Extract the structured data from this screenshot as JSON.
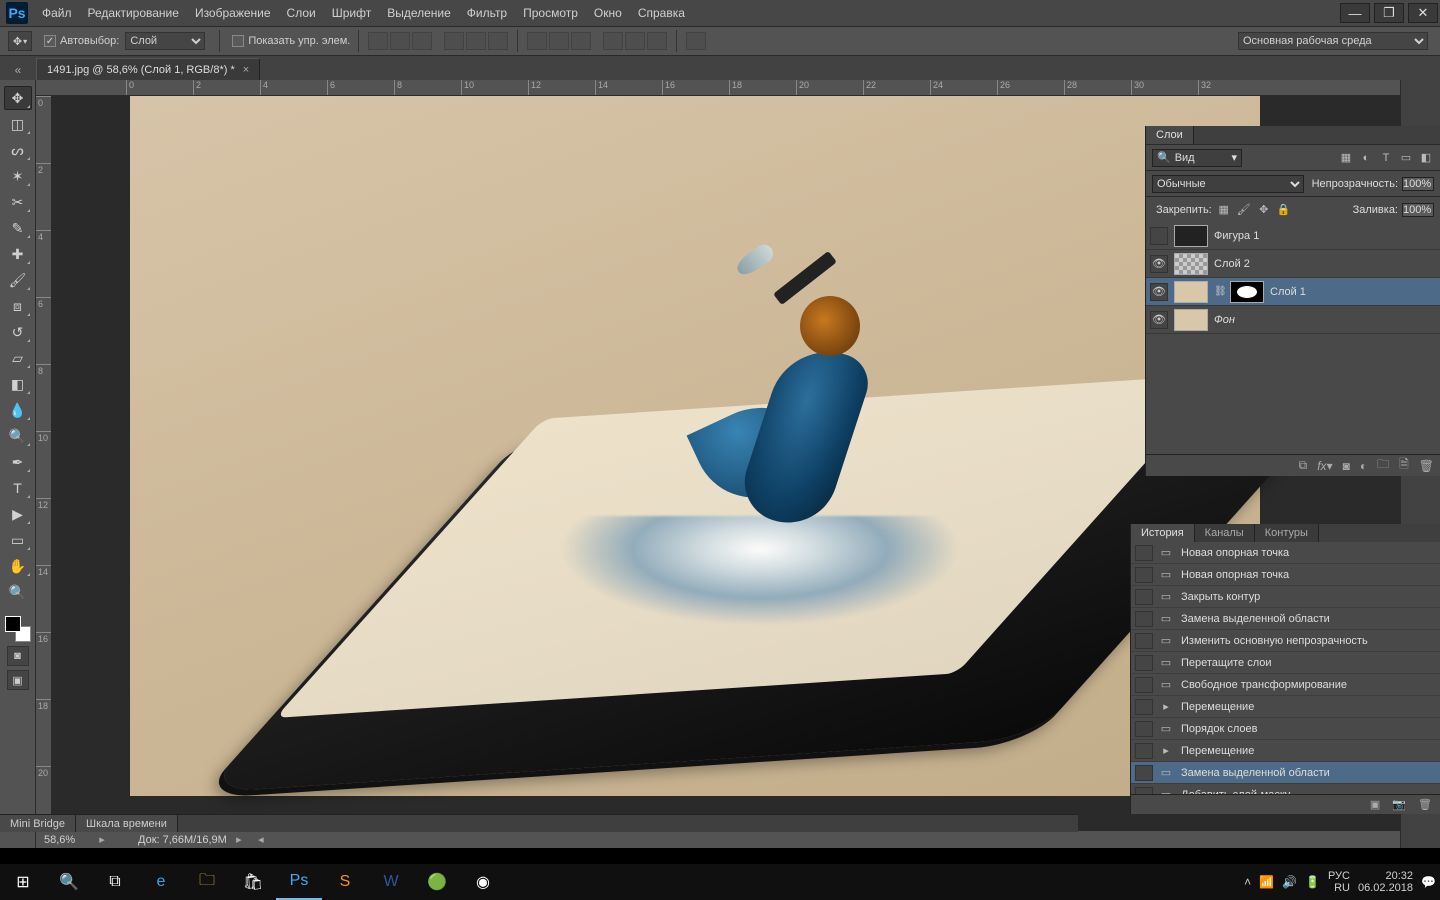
{
  "app": {
    "logo": "Ps"
  },
  "menu": [
    "Файл",
    "Редактирование",
    "Изображение",
    "Слои",
    "Шрифт",
    "Выделение",
    "Фильтр",
    "Просмотр",
    "Окно",
    "Справка"
  ],
  "options": {
    "auto_select_label": "Автовыбор:",
    "auto_select_value": "Слой",
    "show_controls_label": "Показать упр. элем.",
    "workspace": "Основная рабочая среда"
  },
  "document": {
    "tab_title": "1491.jpg @ 58,6% (Слой 1, RGB/8*) *",
    "zoom": "58,6%",
    "doc_size": "Док: 7,66M/16,9M"
  },
  "ruler_ticks": [
    "0",
    "2",
    "4",
    "6",
    "8",
    "10",
    "12",
    "14",
    "16",
    "18",
    "20",
    "22",
    "24",
    "26",
    "28",
    "30",
    "32"
  ],
  "vruler_ticks": [
    "0",
    "2",
    "4",
    "6",
    "8",
    "10",
    "12",
    "14",
    "16",
    "18",
    "20"
  ],
  "layers_panel": {
    "title": "Слои",
    "filter_placeholder": "Вид",
    "blend_mode": "Обычные",
    "opacity_label": "Непрозрачность:",
    "opacity_value": "100%",
    "lock_label": "Закрепить:",
    "fill_label": "Заливка:",
    "fill_value": "100%",
    "layers": [
      {
        "name": "Фигура 1",
        "visible": false,
        "selected": false,
        "thumb": "shape",
        "mask": false,
        "italic": false
      },
      {
        "name": "Слой 2",
        "visible": true,
        "selected": false,
        "thumb": "checker",
        "mask": false,
        "italic": false
      },
      {
        "name": "Слой 1",
        "visible": true,
        "selected": true,
        "thumb": "doc-thumb",
        "mask": true,
        "italic": false
      },
      {
        "name": "Фон",
        "visible": true,
        "selected": false,
        "thumb": "doc-thumb",
        "mask": false,
        "italic": true
      }
    ]
  },
  "history_panel": {
    "tabs": [
      "История",
      "Каналы",
      "Контуры"
    ],
    "active_tab": 0,
    "selected_index": 10,
    "items": [
      "Новая опорная точка",
      "Новая опорная точка",
      "Закрыть контур",
      "Замена выделенной области",
      "Изменить основную непрозрачность",
      "Перетащите слои",
      "Свободное трансформирование",
      "Перемещение",
      "Порядок слоев",
      "Перемещение",
      "Замена выделенной области",
      "Добавить слой-маску"
    ],
    "item_icons": [
      "▭",
      "▭",
      "▭",
      "▭",
      "▭",
      "▭",
      "▭",
      "▸",
      "▭",
      "▸",
      "▭",
      "▭"
    ]
  },
  "bottom_tabs": [
    "Mini Bridge",
    "Шкала времени"
  ],
  "taskbar": {
    "tray_lang": "РУС",
    "tray_kb": "RU",
    "time": "20:32",
    "date": "06.02.2018"
  }
}
